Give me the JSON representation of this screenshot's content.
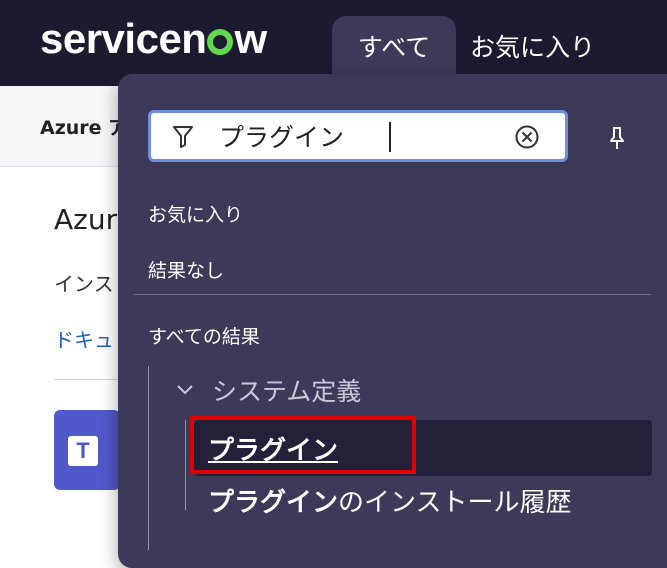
{
  "header": {
    "logo_text_pre": "servicen",
    "logo_text_post": "w",
    "tab_all_label": "すべて",
    "tab_favorites_label": "お気に入り",
    "accent_color": "#62d84e"
  },
  "background_page": {
    "subnav_label": "Azure ア",
    "title": "Azure",
    "line1": "インス",
    "link": "ドキュ"
  },
  "panel": {
    "search": {
      "value": "プラグイン",
      "placeholder": ""
    },
    "favorites_label": "お気に入り",
    "no_results_label": "結果なし",
    "all_results_label": "すべての結果",
    "group": {
      "label": "システム定義",
      "items": [
        {
          "label": "プラグイン"
        },
        {
          "label_bold": "プラグイン",
          "label_rest": "のインストール履歴"
        }
      ]
    },
    "highlight_color": "#e00000"
  }
}
